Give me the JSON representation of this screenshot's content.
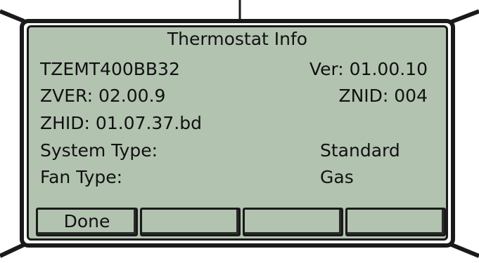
{
  "screen": {
    "title": "Thermostat Info",
    "model": "TZEMT400BB32",
    "version": "Ver: 01.00.10",
    "zver": "ZVER: 02.00.9",
    "znid": "ZNID: 004",
    "zhid": "ZHID: 01.07.37.bd",
    "system_type_label": "System Type:",
    "system_type_value": "Standard",
    "fan_type_label": "Fan Type:",
    "fan_type_value": "Gas"
  },
  "softkeys": [
    {
      "label": "Done"
    },
    {
      "label": ""
    },
    {
      "label": ""
    },
    {
      "label": ""
    }
  ],
  "colors": {
    "lcd_background": "#b2c3b0",
    "frame": "#1a1a1a"
  }
}
